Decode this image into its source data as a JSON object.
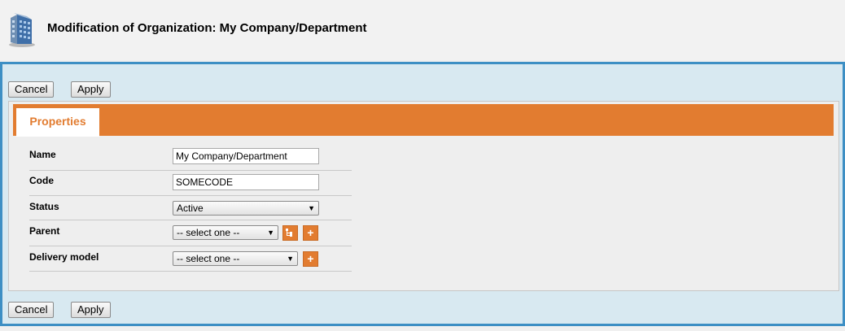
{
  "header": {
    "title": "Modification of Organization: My Company/Department",
    "logo_icon": "building-icon"
  },
  "actions": {
    "cancel_label": "Cancel",
    "apply_label": "Apply"
  },
  "tabs": [
    {
      "label": "Properties",
      "active": true
    }
  ],
  "form": {
    "name": {
      "label": "Name",
      "value": "My Company/Department"
    },
    "code": {
      "label": "Code",
      "value": "SOMECODE"
    },
    "status": {
      "label": "Status",
      "selected": "Active"
    },
    "parent": {
      "label": "Parent",
      "selected": "-- select one --",
      "tree_icon": "tree-select-icon",
      "add_icon": "plus-icon"
    },
    "delivery_model": {
      "label": "Delivery model",
      "selected": "-- select one --",
      "add_icon": "plus-icon"
    }
  },
  "colors": {
    "accent": "#e27c30",
    "frame_border": "#3d8fc4",
    "frame_bg": "#d8e9f1"
  }
}
